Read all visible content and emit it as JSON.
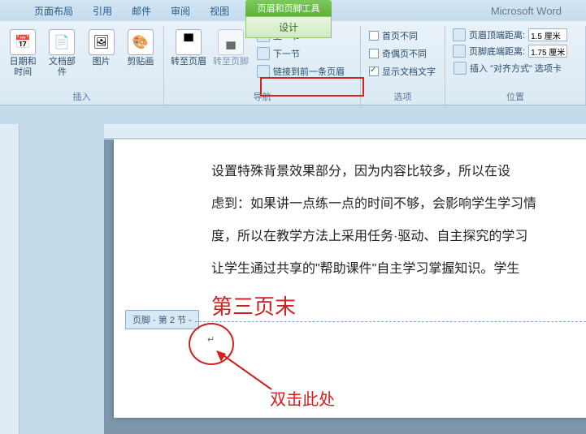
{
  "app_title": "Microsoft Word",
  "context_tool": {
    "title": "页眉和页脚工具",
    "tab": "设计"
  },
  "tabs": [
    "页面布局",
    "引用",
    "邮件",
    "审阅",
    "视图"
  ],
  "ribbon": {
    "insert": {
      "label": "插入",
      "datetime": "日期和时间",
      "docparts": "文档部件",
      "picture": "图片",
      "clipart": "剪贴画"
    },
    "nav": {
      "label": "导航",
      "goto_header": "转至页眉",
      "goto_footer": "转至页脚",
      "prev": "上一节",
      "next": "下一节",
      "link": "链接到前一条页眉"
    },
    "options": {
      "label": "选项",
      "diff_first": "首页不同",
      "diff_odd_even": "奇偶页不同",
      "show_doc_text": "显示文档文字"
    },
    "position": {
      "label": "位置",
      "header_dist_label": "页眉顶端距离:",
      "header_dist_value": "1.5 厘米",
      "footer_dist_label": "页脚底端距离:",
      "footer_dist_value": "1.75 厘米",
      "align_tab": "插入 \"对齐方式\" 选项卡"
    }
  },
  "doc": {
    "para1": "设置特殊背景效果部分，因为内容比较多，所以在设",
    "para2": "虑到：如果讲一点练一点的时间不够，会影响学生学习情",
    "para3": "度，所以在教学方法上采用任务·驱动、自主探究的学习",
    "para4": "让学生通过共享的\"帮助课件\"自主学习掌握知识。学生",
    "red_note": "第三页末",
    "footer_tag": "页脚 - 第 2 节 -",
    "callout": "双击此处",
    "cursor": "↵"
  }
}
